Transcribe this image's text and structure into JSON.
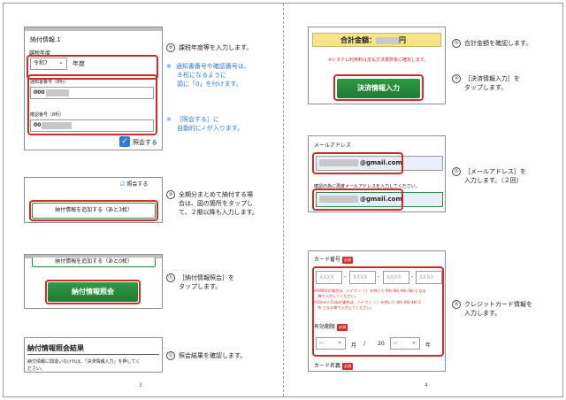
{
  "left_page": {
    "shot1": {
      "title": "納付情報.1",
      "year_label": "課税年度",
      "year_value": "令和7",
      "year_unit": "年度",
      "notice_label": "通知書番号（8桁）",
      "notice_value": "000",
      "confirm_label": "確認番号（8桁）",
      "confirm_value": "00",
      "check_label": "照会する"
    },
    "step9": {
      "num": "⑨",
      "text": "課税年度等を入力します。"
    },
    "note1": {
      "mark": "※",
      "lines": [
        "通知書番号や確認番号は、",
        "８桁になるように",
        "頭に「0」を付けます。"
      ]
    },
    "note2": {
      "mark": "※",
      "lines": [
        "［照会する］に",
        "自動的に✓が入ります。"
      ]
    },
    "shot2": {
      "check_label": "照会する",
      "button": "納付情報を追加する（あと3枚）"
    },
    "step10": {
      "num": "⑩",
      "lines": [
        "全期分まとめて納付する場",
        "合は、図の箇所をタップし",
        "て、２期以降も入力します。"
      ]
    },
    "shot3": {
      "outline_button": "納付情報を追加する（あと0枚）",
      "button": "納付情報照会"
    },
    "step11": {
      "num": "⑪",
      "lines": [
        "［納付情報照会］を",
        "タップします。"
      ]
    },
    "shot4": {
      "title": "納付情報照会結果",
      "text_lines": [
        "納付情報に間違いなければ、「決済情報入力」を押してく",
        "ださい。"
      ]
    },
    "step12": {
      "num": "⑫",
      "text": "照会結果を確認します。"
    },
    "page_number": "3"
  },
  "right_page": {
    "shot5": {
      "total_label": "合計金額：",
      "total_unit": "円",
      "notice": "※システム利用料は支払方法選択後に確定します。",
      "button": "決済情報入力"
    },
    "step13": {
      "num": "⑬",
      "text": "合計金額を確認します。"
    },
    "step14": {
      "num": "⑭",
      "lines": [
        "［決済情報入力］を",
        "タップします。"
      ]
    },
    "shot6": {
      "label": "メールアドレス",
      "email1": "@gmail.com",
      "confirm_note": "確認の為に再度メールアドレスを入力してください。",
      "email2": "@gmail.com"
    },
    "step15": {
      "num": "⑮",
      "lines": [
        "［メールアドレス］を",
        "入力します。（２回）"
      ]
    },
    "shot7": {
      "card_label": "カード番号",
      "badge": "必須",
      "placeholders": [
        "XXXX",
        "XXXX",
        "XXXX",
        "XXXX"
      ],
      "amex_note": [
        "※AMEXの場合は、ハイフン（-）を除いて 4桁-4桁-4桁-3桁 となる",
        "　様で入力してください。"
      ],
      "diners_note": [
        "※Diners Clubの場合は、ハイフン（-）を除いて 4桁-4桁-4桁-2",
        "　桁 となる様で入力してください。"
      ],
      "expiry_label": "有効期限",
      "month_value": "--",
      "month_unit": "月",
      "slash": "/",
      "year_prefix": "20",
      "year_value": "--",
      "year_unit": "年",
      "name_label": "カード名義"
    },
    "step16": {
      "num": "⑯",
      "lines": [
        "クレジットカード情報を",
        "入力します。"
      ]
    },
    "page_number": "4"
  }
}
